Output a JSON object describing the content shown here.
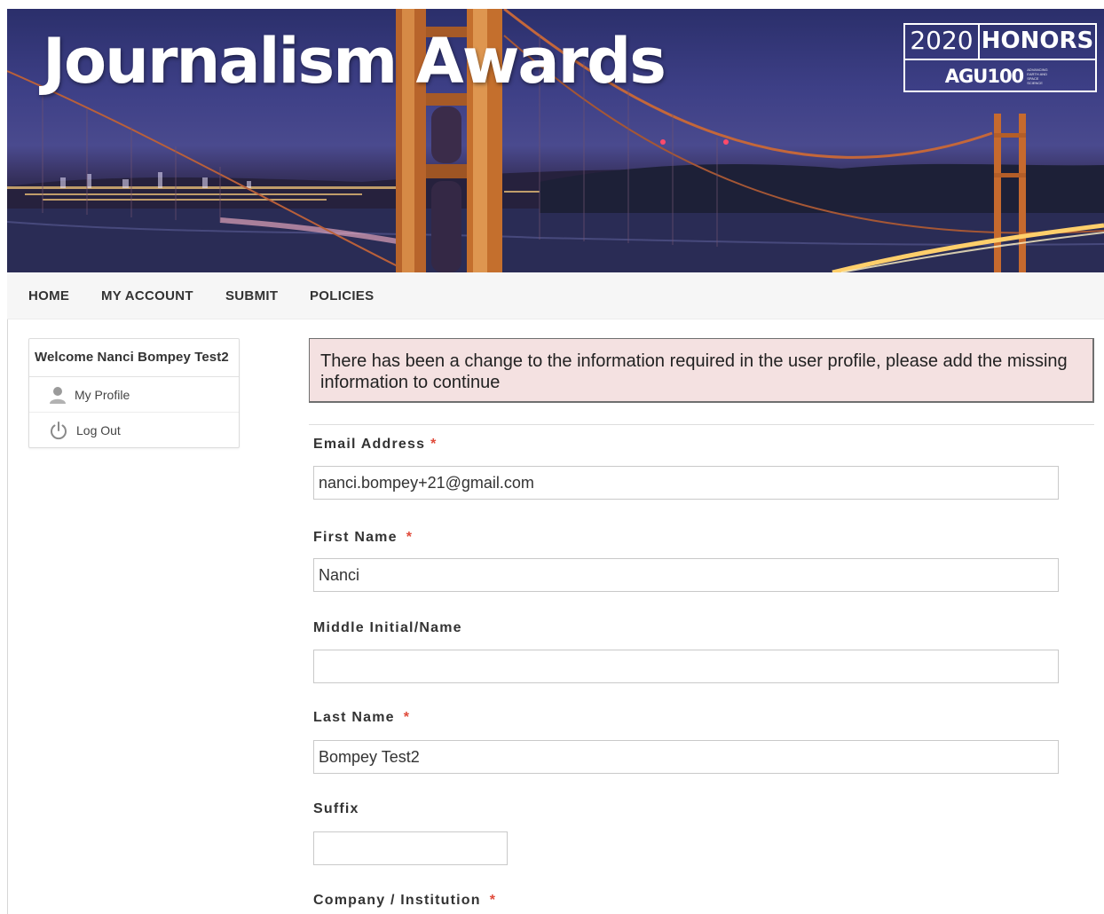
{
  "banner": {
    "title": "Journalism Awards",
    "badge_year": "2020",
    "badge_word": "HONORS",
    "badge_org": "AGU100",
    "badge_tagline": "ADVANCING EARTH AND SPACE SCIENCE"
  },
  "nav": {
    "items": [
      "HOME",
      "MY ACCOUNT",
      "SUBMIT",
      "POLICIES"
    ]
  },
  "sidebar": {
    "welcome": "Welcome Nanci Bompey Test2",
    "items": [
      {
        "label": "My Profile",
        "icon": "user-icon"
      },
      {
        "label": "Log Out",
        "icon": "power-icon"
      }
    ]
  },
  "alert": {
    "message": "There has been a change to the information required in the user profile, please add the missing information to continue"
  },
  "form": {
    "required_marker": "*",
    "email": {
      "label": "Email Address",
      "value": "nanci.bompey+21@gmail.com"
    },
    "first_name": {
      "label": "First Name",
      "value": "Nanci"
    },
    "middle_name": {
      "label": "Middle Initial/Name",
      "value": ""
    },
    "last_name": {
      "label": "Last Name",
      "value": "Bompey Test2"
    },
    "suffix": {
      "label": "Suffix",
      "value": ""
    },
    "company": {
      "label": "Company / Institution"
    }
  },
  "colors": {
    "required": "#e04a3a",
    "alert_bg": "#f4e1e1",
    "nav_bg": "#f6f6f6"
  }
}
